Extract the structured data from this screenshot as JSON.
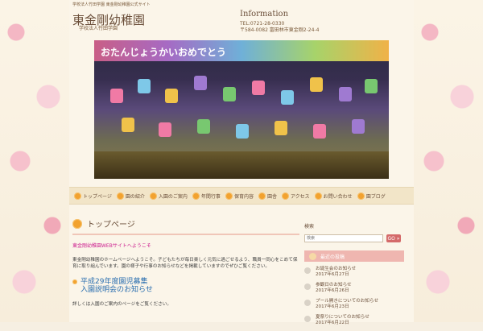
{
  "header": {
    "topline": "学校法人竹田学園 東金剛幼稚園公式サイト",
    "logo_title": "東金剛幼稚園",
    "logo_subtitle": "学校法人竹田学園",
    "info_title": "Information",
    "tel": "TEL:0721-28-0330",
    "address": "〒584-0082 富田林市東金剛2-24-4"
  },
  "hero": {
    "banner_text": "おたんじょうかいおめでとう"
  },
  "nav": {
    "items": [
      {
        "label": "トップページ"
      },
      {
        "label": "園の紹介"
      },
      {
        "label": "入園のご案内"
      },
      {
        "label": "年間行事"
      },
      {
        "label": "保育内容"
      },
      {
        "label": "園舎"
      },
      {
        "label": "アクセス"
      },
      {
        "label": "お問い合わせ"
      },
      {
        "label": "園ブログ"
      }
    ]
  },
  "main": {
    "section_title": "トップページ",
    "notice": "東金剛幼稚園WEBサイトへようこそ",
    "paragraph": "東金剛幼稚園のホームページへようこそ。子どもたちが毎日楽しく元気に過ごせるよう、職員一同心をこめて保育に取り組んでいます。園の様子や行事のお知らせなどを掲載していますのでぜひご覧ください。",
    "subheading_line1": "平成29年度園児募集",
    "subheading_line2": "入園説明会のお知らせ",
    "small_note": "詳しくは入園のご案内のページをご覧ください。"
  },
  "sidebar": {
    "search_label": "検索",
    "search_placeholder": "検索",
    "go_label": "GO »",
    "recent_title": "最近の投稿",
    "recent_posts": [
      {
        "title": "お誕生会のお知らせ",
        "date": "2017年6月27日"
      },
      {
        "title": "参観日のお知らせ",
        "date": "2017年6月26日"
      },
      {
        "title": "プール開きについてのお知らせ",
        "date": "2017年6月23日"
      },
      {
        "title": "夏祭りについてのお知らせ",
        "date": "2017年6月22日"
      }
    ]
  }
}
